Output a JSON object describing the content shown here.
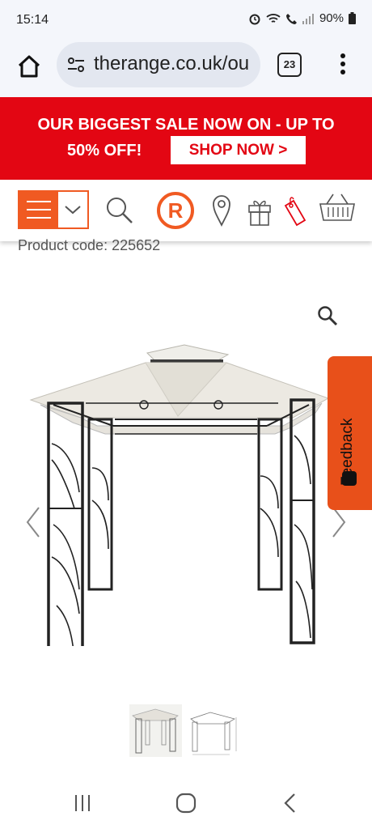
{
  "status_bar": {
    "time": "15:14",
    "battery": "90%"
  },
  "browser": {
    "url": "therange.co.uk/ou",
    "tab_count": "23"
  },
  "banner": {
    "line1": "OUR BIGGEST SALE NOW ON - UP TO",
    "line2": "50% OFF!",
    "cta": "SHOP NOW >"
  },
  "nav": {
    "logo_letter": "R",
    "icons": [
      "menu-icon",
      "chevron-down-icon",
      "search-icon",
      "store-locator-icon",
      "gift-icon",
      "price-tag-icon",
      "basket-icon"
    ]
  },
  "product": {
    "code_text": "Product code: 225652"
  },
  "feedback": {
    "label": "Feedback"
  },
  "colors": {
    "brand_red": "#e30613",
    "brand_orange": "#f05a22",
    "feedback_orange": "#e8501a"
  }
}
